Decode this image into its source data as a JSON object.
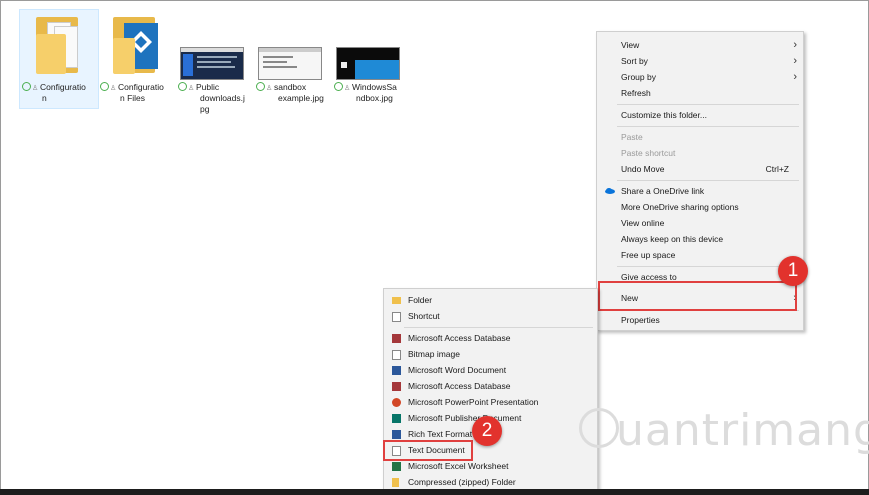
{
  "files": [
    {
      "name_line1": "Configuratio",
      "name_line2": "n",
      "name_line3": "",
      "kind": "folder-docs"
    },
    {
      "name_line1": "Configuratio",
      "name_line2": "n Files",
      "name_line3": "",
      "kind": "folder-app"
    },
    {
      "name_line1": "Public",
      "name_line2": "downloads.j",
      "name_line3": "pg",
      "kind": "image"
    },
    {
      "name_line1": "sandbox",
      "name_line2": "example.jpg",
      "name_line3": "",
      "kind": "image"
    },
    {
      "name_line1": "WindowsSa",
      "name_line2": "ndbox.jpg",
      "name_line3": "",
      "kind": "image"
    }
  ],
  "context_menu": {
    "view": "View",
    "sort_by": "Sort by",
    "group_by": "Group by",
    "refresh": "Refresh",
    "customize": "Customize this folder...",
    "paste": "Paste",
    "paste_shortcut": "Paste shortcut",
    "undo_move": "Undo Move",
    "undo_shortcut": "Ctrl+Z",
    "share_onedrive": "Share a OneDrive link",
    "more_onedrive": "More OneDrive sharing options",
    "view_online": "View online",
    "always_keep": "Always keep on this device",
    "free_up": "Free up space",
    "give_access": "Give access to",
    "new": "New",
    "properties": "Properties"
  },
  "submenu": {
    "folder": "Folder",
    "shortcut": "Shortcut",
    "access_db_1": "Microsoft Access Database",
    "bitmap": "Bitmap image",
    "word_doc": "Microsoft Word Document",
    "access_db_2": "Microsoft Access Database",
    "powerpoint": "Microsoft PowerPoint Presentation",
    "publisher": "Microsoft Publisher Document",
    "rich_text": "Rich Text Format",
    "text_doc": "Text Document",
    "excel": "Microsoft Excel Worksheet",
    "zip": "Compressed (zipped) Folder"
  },
  "badges": {
    "one": "1",
    "two": "2"
  },
  "watermark": "uantrimang",
  "colors": {
    "highlight": "#e0403f",
    "badge": "#e2322d",
    "menu_bg": "#f2f2f2",
    "onedrive": "#0a74da"
  }
}
